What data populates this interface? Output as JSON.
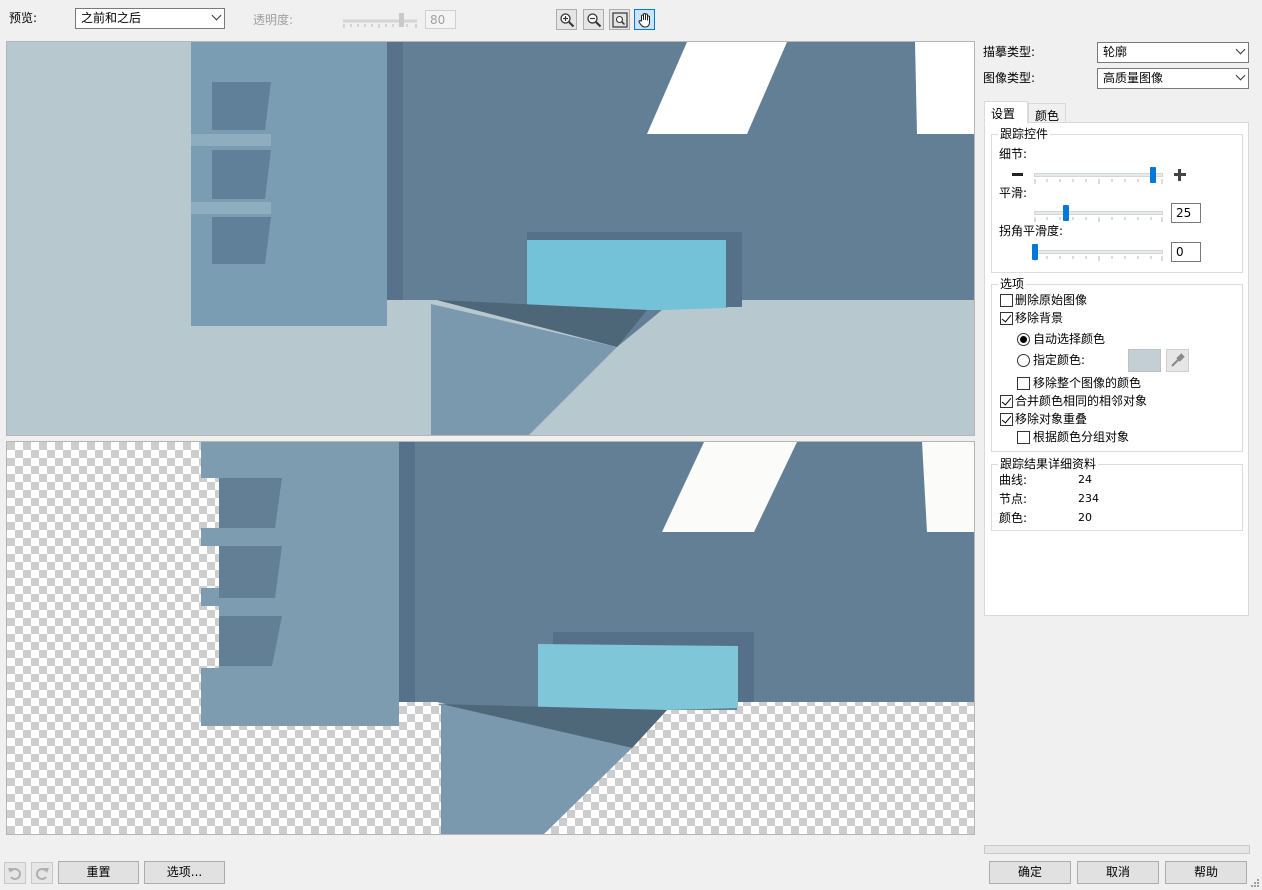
{
  "toolbar": {
    "preview_label": "预览:",
    "preview_mode": "之前和之后",
    "transparency_label": "透明度:",
    "transparency_value": "80",
    "icons": [
      "zoom-in-icon",
      "zoom-out-icon",
      "zoom-fit-icon",
      "pan-hand-icon"
    ]
  },
  "settings": {
    "trace_type_label": "描摹类型:",
    "trace_type_value": "轮廓",
    "image_type_label": "图像类型:",
    "image_type_value": "高质量图像"
  },
  "tabs": [
    "设置",
    "颜色"
  ],
  "trace_controls": {
    "title": "跟踪控件",
    "detail_label": "细节:",
    "detail_level": 0.93,
    "smoothing_label": "平滑:",
    "smoothing_value": "25",
    "corner_label": "拐角平滑度:",
    "corner_value": "0"
  },
  "options": {
    "title": "选项",
    "delete_original": "删除原始图像",
    "remove_background": "移除背景",
    "auto_select_color": "自动选择颜色",
    "specify_color": "指定颜色:",
    "remove_whole_image_color": "移除整个图像的颜色",
    "merge_adjacent": "合并颜色相同的相邻对象",
    "remove_overlap": "移除对象重叠",
    "group_by_color": "根据颜色分组对象",
    "bg_color_swatch": "#c3ced5"
  },
  "results": {
    "title": "跟踪结果详细资料",
    "curves_label": "曲线:",
    "curves_value": "24",
    "nodes_label": "节点:",
    "nodes_value": "234",
    "colors_label": "颜色:",
    "colors_value": "20"
  },
  "bottom": {
    "reset": "重置",
    "options": "选项...",
    "ok": "确定",
    "cancel": "取消",
    "help": "帮助"
  }
}
